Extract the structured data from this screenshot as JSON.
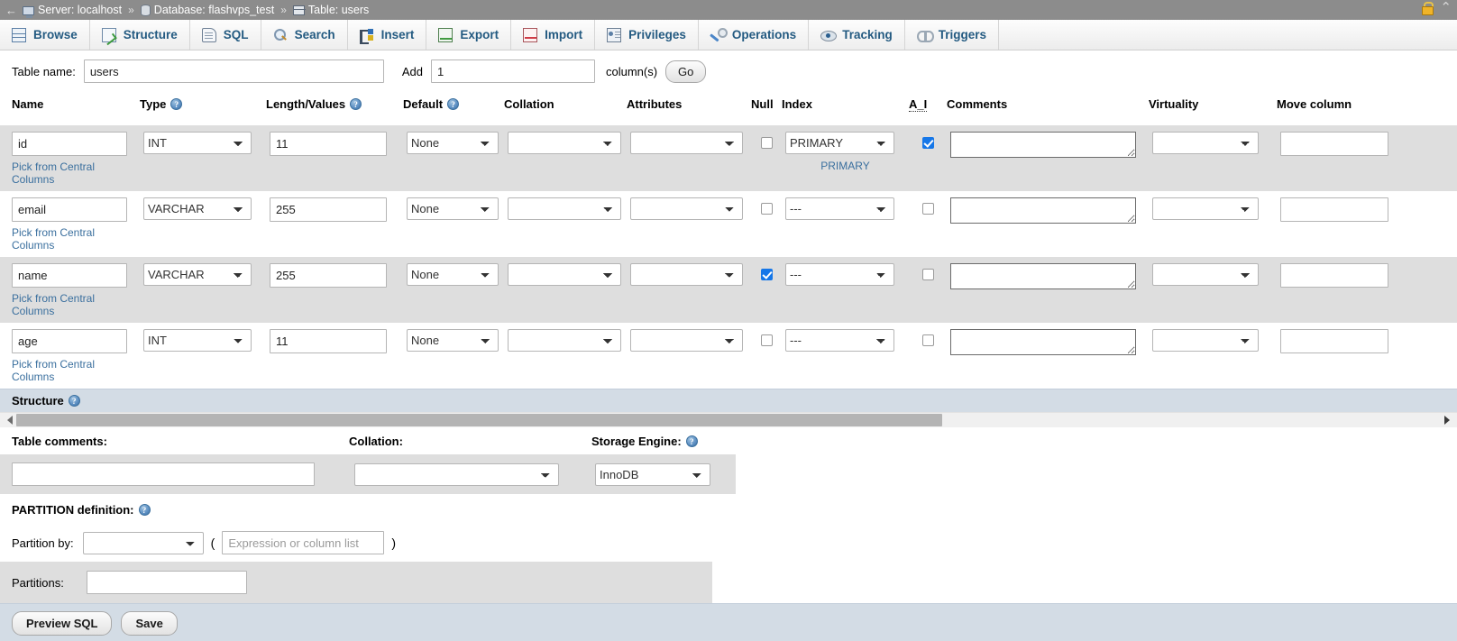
{
  "breadcrumb": {
    "back_arrow": "←",
    "items": [
      {
        "icon": "server-icon",
        "label": "Server: localhost"
      },
      {
        "icon": "database-icon",
        "label": "Database: flashvps_test"
      },
      {
        "icon": "table-icon",
        "label": "Table: users"
      }
    ],
    "separator": "»",
    "lock_icon": "lock-icon",
    "collapse_icon": "collapse-up-icon",
    "collapse_glyph": "⌃"
  },
  "tabs": [
    {
      "label": "Browse",
      "icon": "browse-icon"
    },
    {
      "label": "Structure",
      "icon": "structure-icon"
    },
    {
      "label": "SQL",
      "icon": "sql-icon"
    },
    {
      "label": "Search",
      "icon": "search-icon"
    },
    {
      "label": "Insert",
      "icon": "insert-icon"
    },
    {
      "label": "Export",
      "icon": "export-icon"
    },
    {
      "label": "Import",
      "icon": "import-icon"
    },
    {
      "label": "Privileges",
      "icon": "privileges-icon"
    },
    {
      "label": "Operations",
      "icon": "operations-icon"
    },
    {
      "label": "Tracking",
      "icon": "tracking-icon"
    },
    {
      "label": "Triggers",
      "icon": "triggers-icon"
    }
  ],
  "table_form": {
    "table_name_label": "Table name:",
    "table_name_value": "users",
    "add_label": "Add",
    "add_count_value": "1",
    "columns_label": "column(s)",
    "go_button": "Go"
  },
  "grid": {
    "headers": {
      "name": "Name",
      "type": "Type",
      "length": "Length/Values",
      "default": "Default",
      "collation": "Collation",
      "attributes": "Attributes",
      "null": "Null",
      "index": "Index",
      "ai": "A_I",
      "comments": "Comments",
      "virtuality": "Virtuality",
      "move_column": "Move column"
    },
    "help_glyph": "?",
    "central_link": "Pick from Central Columns",
    "rows": [
      {
        "name": "id",
        "type": "INT",
        "length": "11",
        "default": "None",
        "collation": "",
        "attributes": "",
        "null": false,
        "index": "PRIMARY",
        "index_note": "PRIMARY",
        "ai": true,
        "comments": "",
        "virtuality": "",
        "move_column": ""
      },
      {
        "name": "email",
        "type": "VARCHAR",
        "length": "255",
        "default": "None",
        "collation": "",
        "attributes": "",
        "null": false,
        "index": "---",
        "index_note": "",
        "ai": false,
        "comments": "",
        "virtuality": "",
        "move_column": ""
      },
      {
        "name": "name",
        "type": "VARCHAR",
        "length": "255",
        "default": "None",
        "collation": "",
        "attributes": "",
        "null": true,
        "index": "---",
        "index_note": "",
        "ai": false,
        "comments": "",
        "virtuality": "",
        "move_column": ""
      },
      {
        "name": "age",
        "type": "INT",
        "length": "11",
        "default": "None",
        "collation": "",
        "attributes": "",
        "null": false,
        "index": "---",
        "index_note": "",
        "ai": false,
        "comments": "",
        "virtuality": "",
        "move_column": ""
      }
    ]
  },
  "structure_section": {
    "title": "Structure"
  },
  "table_options": {
    "comments_label": "Table comments:",
    "comments_value": "",
    "collation_label": "Collation:",
    "collation_value": "",
    "engine_label": "Storage Engine:",
    "engine_value": "InnoDB"
  },
  "partition": {
    "title": "PARTITION definition:",
    "by_label": "Partition by:",
    "by_value": "",
    "open_paren": "(",
    "close_paren": ")",
    "expression_placeholder": "Expression or column list",
    "expression_value": "",
    "partitions_label": "Partitions:",
    "partitions_value": ""
  },
  "footer": {
    "preview_sql": "Preview SQL",
    "save": "Save"
  },
  "colors": {
    "breadcrumb_bg": "#8c8c8c",
    "tab_text": "#235a81",
    "link": "#3a6f9e",
    "row_odd_bg": "#dedede",
    "panel_header_bg": "#d3dce5",
    "checkbox_checked": "#1677e8"
  }
}
